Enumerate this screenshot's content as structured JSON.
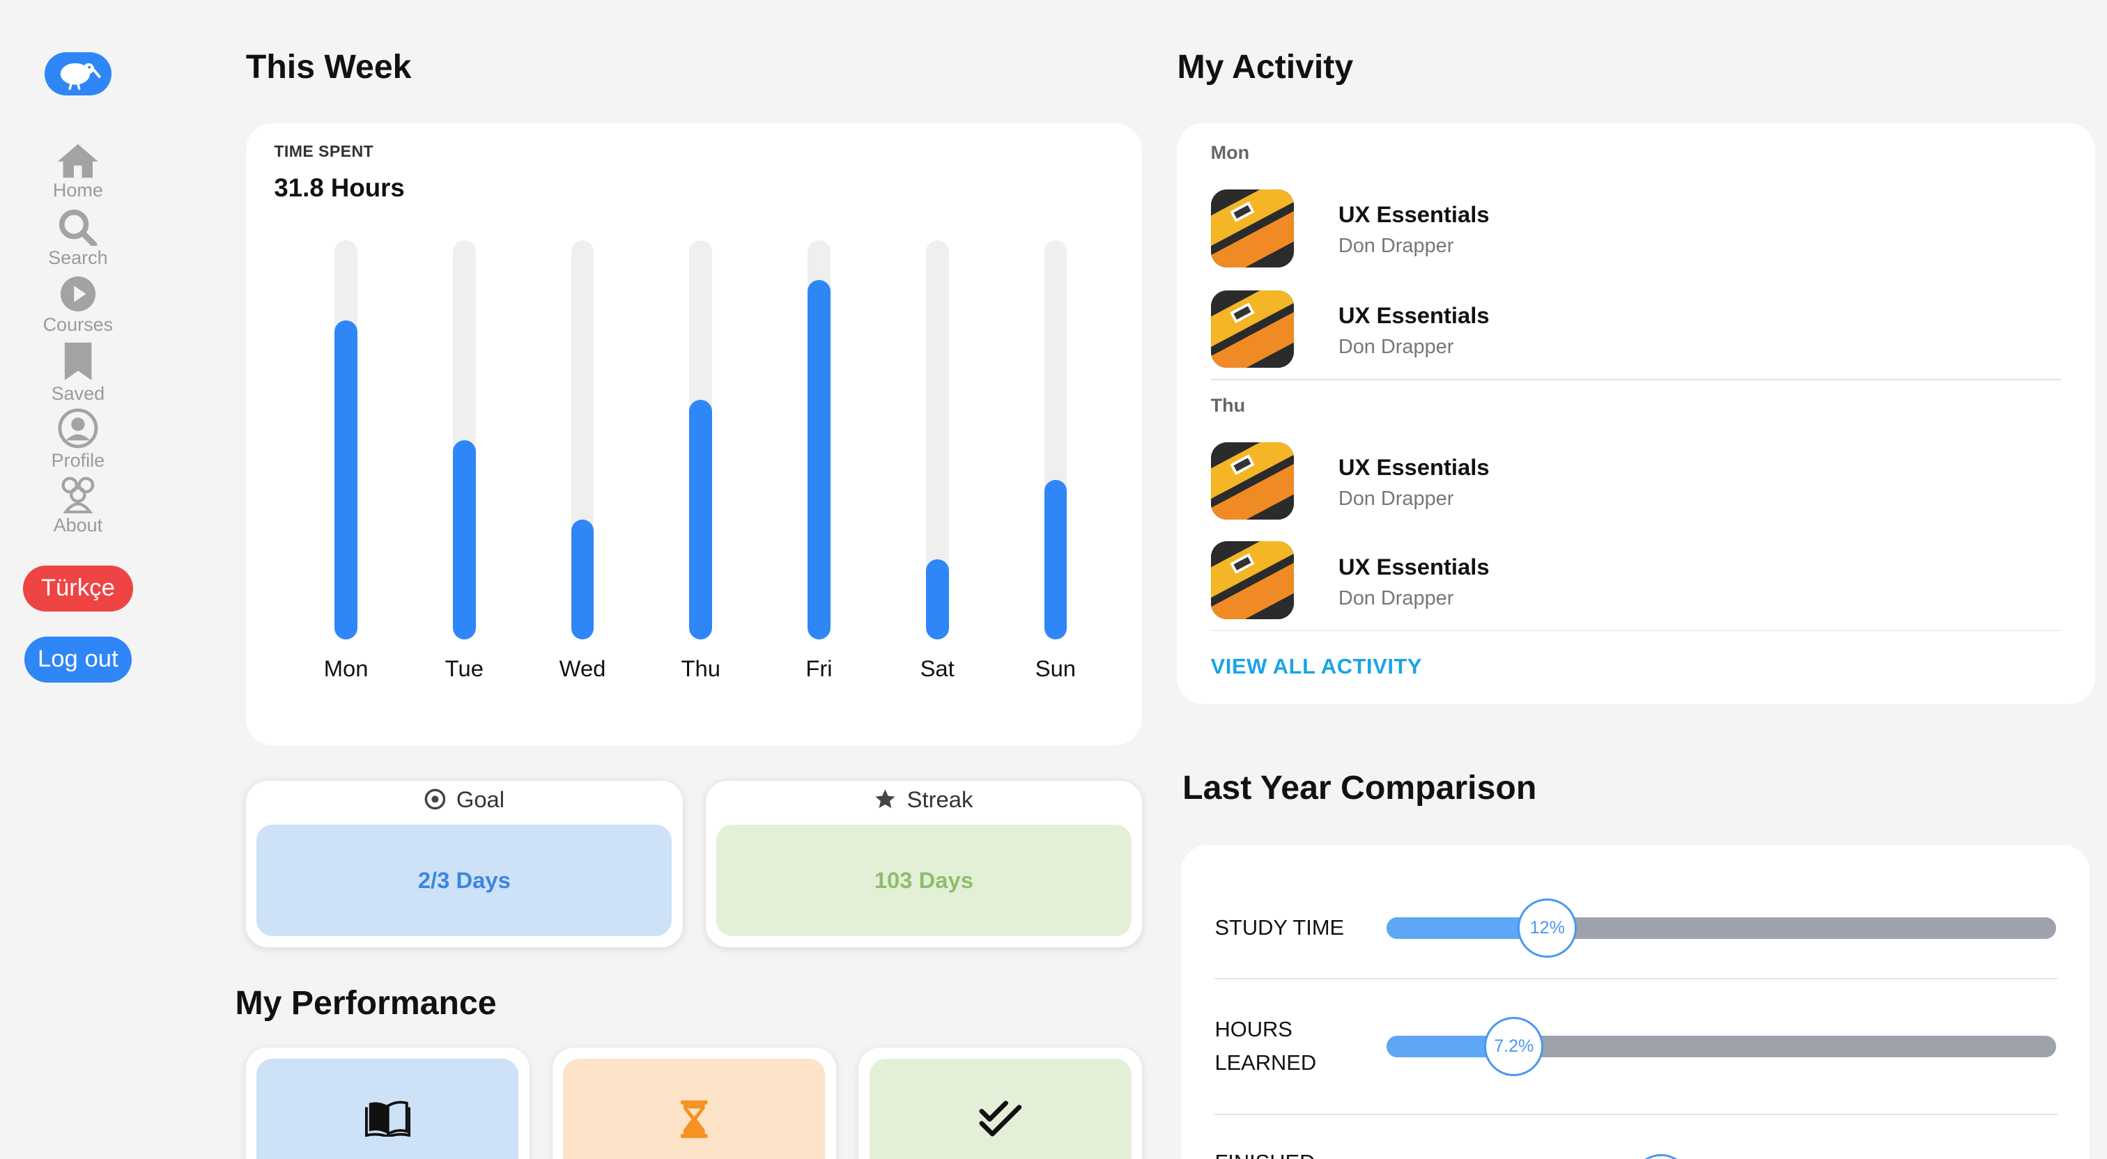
{
  "sidebar": {
    "logo_icon": "kiwi-bird-icon",
    "items": [
      {
        "label": "Home",
        "icon": "home-icon"
      },
      {
        "label": "Search",
        "icon": "search-icon"
      },
      {
        "label": "Courses",
        "icon": "play-circle-icon"
      },
      {
        "label": "Saved",
        "icon": "bookmark-icon"
      },
      {
        "label": "Profile",
        "icon": "user-circle-icon"
      },
      {
        "label": "About",
        "icon": "users-icon"
      }
    ],
    "language_button": "Türkçe",
    "logout_button": "Log out"
  },
  "this_week": {
    "title": "This Week",
    "time_spent_label": "TIME SPENT",
    "time_spent_value": "31.8 Hours"
  },
  "chart_data": {
    "type": "bar",
    "categories": [
      "Mon",
      "Tue",
      "Wed",
      "Thu",
      "Fri",
      "Sat",
      "Sun"
    ],
    "values": [
      0.8,
      0.5,
      0.3,
      0.6,
      0.9,
      0.2,
      0.4
    ],
    "ylim": [
      0,
      1
    ],
    "bar_color": "#2f86f6",
    "track_color": "#efefef"
  },
  "goal": {
    "label": "Goal",
    "value": "2/3 Days",
    "icon": "target-icon"
  },
  "streak": {
    "label": "Streak",
    "value": "103 Days",
    "icon": "star-icon"
  },
  "performance": {
    "title": "My Performance",
    "cards": [
      {
        "icon": "open-book-icon",
        "color": "#cde1f7"
      },
      {
        "icon": "hourglass-icon",
        "color": "#fde3c8"
      },
      {
        "icon": "double-check-icon",
        "color": "#e3f0d7"
      }
    ]
  },
  "activity": {
    "title": "My Activity",
    "groups": [
      {
        "day": "Mon",
        "items": [
          {
            "title": "UX Essentials",
            "author": "Don Drapper"
          },
          {
            "title": "UX Essentials",
            "author": "Don Drapper"
          }
        ]
      },
      {
        "day": "Thu",
        "items": [
          {
            "title": "UX Essentials",
            "author": "Don Drapper"
          },
          {
            "title": "UX Essentials",
            "author": "Don Drapper"
          }
        ]
      }
    ],
    "view_all": "VIEW ALL ACTIVITY"
  },
  "comparison": {
    "title": "Last Year Comparison",
    "rows": [
      {
        "label": "STUDY TIME",
        "value": "12%",
        "fraction": 0.24
      },
      {
        "label": "HOURS LEARNED",
        "value": "7.2%",
        "fraction": 0.19
      },
      {
        "label": "FINISHED",
        "value": "",
        "fraction": 0.41
      }
    ]
  },
  "colors": {
    "accent": "#2f86f6",
    "danger": "#ef4444",
    "goal_bg": "#cde1f7",
    "goal_text": "#3b86e0",
    "streak_bg": "#e3f0d7",
    "streak_text": "#8fbe6a",
    "link": "#1aa3e8"
  }
}
